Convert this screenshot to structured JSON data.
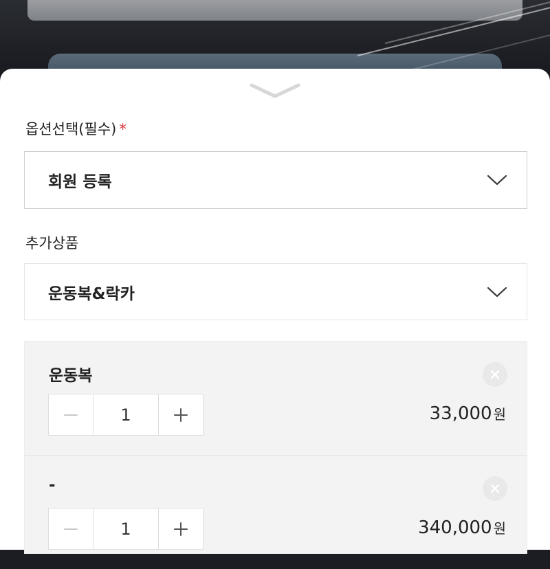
{
  "option_select": {
    "label": "옵션선택(필수)",
    "required_mark": "*",
    "selected_value": "회원 등록"
  },
  "addon": {
    "label": "추가상품",
    "selected_value": "운동복&락카"
  },
  "cart_items": [
    {
      "name": "운동복",
      "quantity": "1",
      "price": "33,000",
      "currency": "원"
    },
    {
      "name": "-",
      "quantity": "1",
      "price": "340,000",
      "currency": "원"
    }
  ],
  "icons": {
    "sheet_handle": "chevron-down-icon",
    "dropdown": "chevron-down-icon",
    "remove": "close-circle-icon",
    "decrement": "minus-icon",
    "increment": "plus-icon"
  },
  "colors": {
    "required": "#e0393e",
    "item_panel_bg": "#f3f3f3",
    "remove_button_bg": "#e9e9e9"
  }
}
